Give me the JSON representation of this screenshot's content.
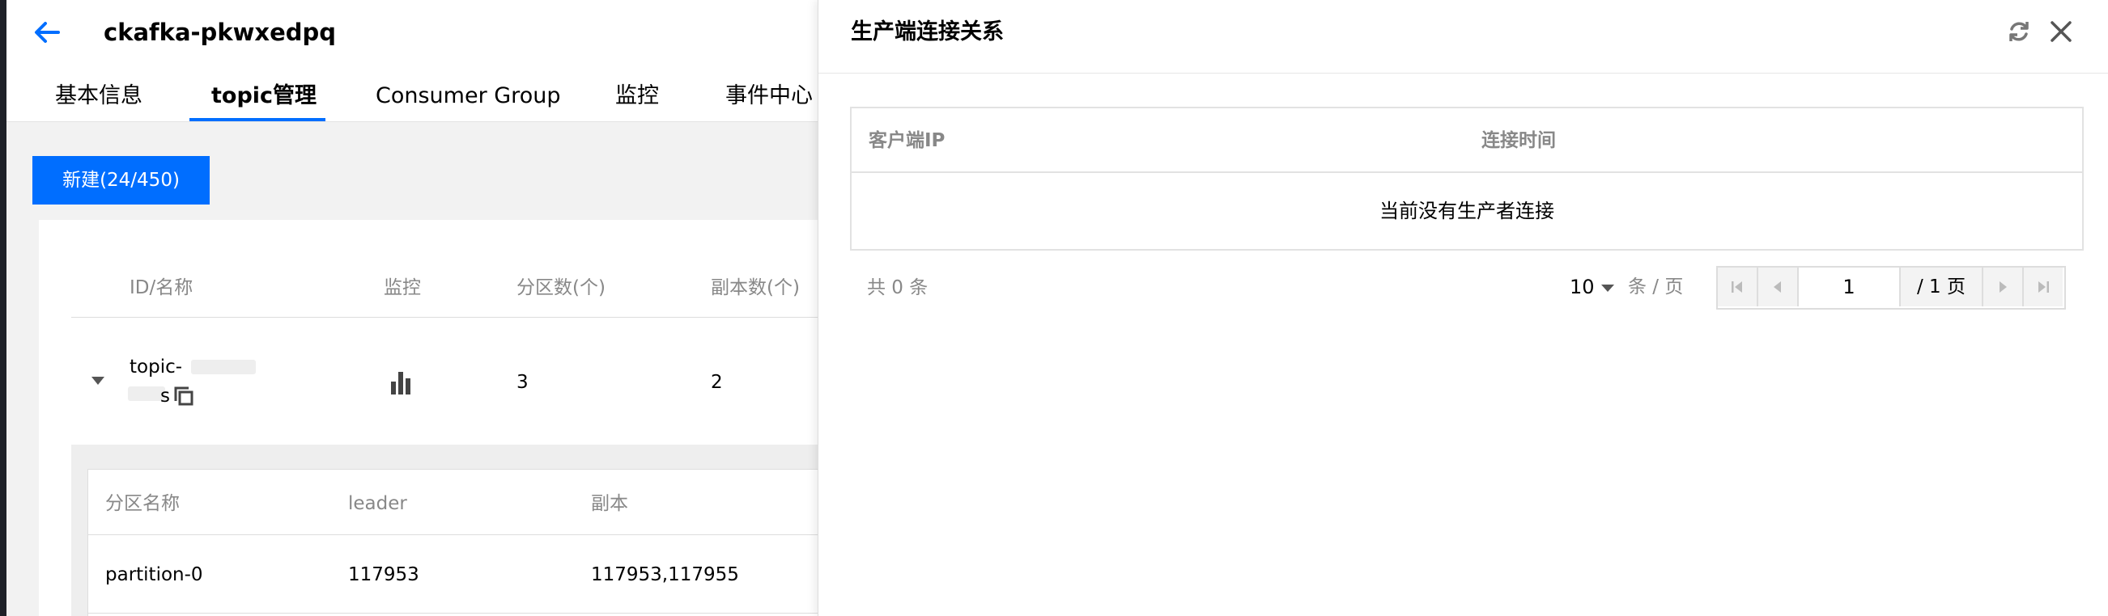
{
  "page": {
    "title": "ckafka-pkwxedpq",
    "tabs": [
      {
        "label": "基本信息",
        "active": false
      },
      {
        "label": "topic管理",
        "active": true
      },
      {
        "label": "Consumer Group",
        "active": false
      },
      {
        "label": "监控",
        "active": false
      },
      {
        "label": "事件中心",
        "active": false
      }
    ],
    "new_button_label": "新建(24/450)",
    "topic_table": {
      "columns": [
        "ID/名称",
        "监控",
        "分区数(个)",
        "副本数(个)"
      ],
      "rows": [
        {
          "name_line1": "topic-",
          "name_line2": "s",
          "partitions": "3",
          "replicas": "2",
          "monitor_icon": "bar-chart-icon"
        }
      ]
    },
    "partition_table": {
      "columns": [
        "分区名称",
        "leader",
        "副本"
      ],
      "rows": [
        {
          "name": "partition-0",
          "leader": "117953",
          "replicas": "117953,117955"
        }
      ]
    }
  },
  "drawer": {
    "title": "生产端连接关系",
    "columns": [
      "客户端IP",
      "连接时间"
    ],
    "empty_text": "当前没有生产者连接",
    "total_text": "共 0 条",
    "page_size": "10",
    "page_size_unit": "条 / 页",
    "current_page": "1",
    "total_pages": "/ 1 页"
  },
  "colors": {
    "accent": "#006eff",
    "muted_text": "#888888",
    "border": "#dddddd"
  }
}
